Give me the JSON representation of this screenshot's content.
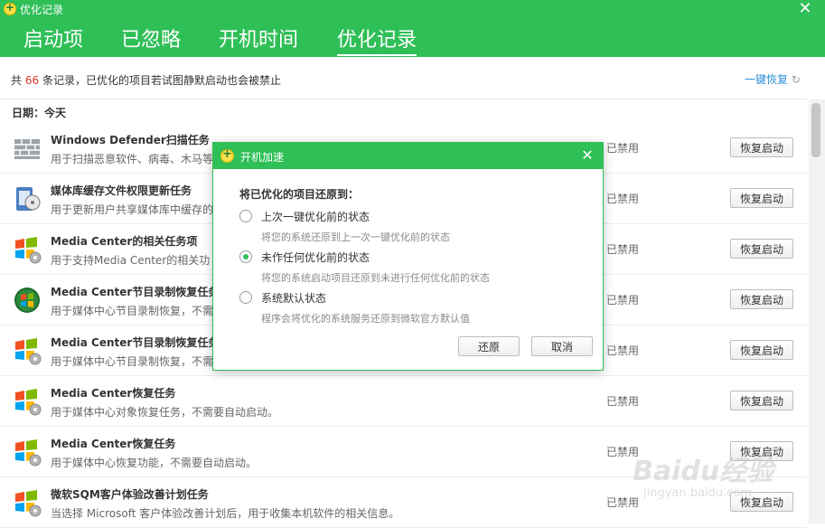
{
  "window": {
    "title": "优化记录",
    "close_glyph": "✕"
  },
  "tabs": [
    {
      "label": "启动项",
      "active": false
    },
    {
      "label": "已忽略",
      "active": false
    },
    {
      "label": "开机时间",
      "active": false
    },
    {
      "label": "优化记录",
      "active": true
    }
  ],
  "summary": {
    "prefix": "共",
    "count": "66",
    "suffix": "条记录，已优化的项目若试图静默启动也会被禁止"
  },
  "restore_all": {
    "label": "一键恢复",
    "icon": "refresh-icon"
  },
  "date_label": "日期：今天",
  "records": [
    {
      "icon": "wall-icon",
      "name": "Windows Defender扫描任务",
      "desc": "用于扫描恶意软件、病毒、木马等",
      "status": "已禁用",
      "button": "恢复启动"
    },
    {
      "icon": "media-library-icon",
      "name": "媒体库缓存文件权限更新任务",
      "desc": "用于更新用户共享媒体库中缓存的",
      "status": "已禁用",
      "button": "恢复启动"
    },
    {
      "icon": "windows-gear-icon",
      "name": "Media Center的相关任务项",
      "desc": "用于支持Media Center的相关功",
      "status": "已禁用",
      "button": "恢复启动"
    },
    {
      "icon": "windows-orb-icon",
      "name": "Media Center节目录制恢复任务",
      "desc": "用于媒体中心节目录制恢复，不需",
      "status": "已禁用",
      "button": "恢复启动"
    },
    {
      "icon": "windows-gear-icon",
      "name": "Media Center节目录制恢复任务",
      "desc": "用于媒体中心节目录制恢复，不需",
      "status": "已禁用",
      "button": "恢复启动"
    },
    {
      "icon": "windows-gear-icon",
      "name": "Media Center恢复任务",
      "desc": "用于媒体中心对象恢复任务，不需要自动启动。",
      "status": "已禁用",
      "button": "恢复启动"
    },
    {
      "icon": "windows-gear-icon",
      "name": "Media Center恢复任务",
      "desc": "用于媒体中心恢复功能，不需要自动启动。",
      "status": "已禁用",
      "button": "恢复启动"
    },
    {
      "icon": "windows-gear-icon",
      "name": "微软SQM客户体验改善计划任务",
      "desc": "当选择 Microsoft 客户体验改善计划后，用于收集本机软件的相关信息。",
      "status": "已禁用",
      "button": "恢复启动"
    }
  ],
  "dialog": {
    "title": "开机加速",
    "prompt": "将已优化的项目还原到：",
    "options": [
      {
        "label": "上次一键优化前的状态",
        "desc": "将您的系统还原到上一次一键优化前的状态",
        "checked": false
      },
      {
        "label": "未作任何优化前的状态",
        "desc": "将您的系统启动项目还原到未进行任何优化前的状态",
        "checked": true
      },
      {
        "label": "系统默认状态",
        "desc": "程序会将优化的系统服务还原到微软官方默认值",
        "checked": false
      }
    ],
    "restore_button": "还原",
    "cancel_button": "取消",
    "close_glyph": "✕"
  },
  "watermark": {
    "text": "Baidu经验",
    "sub": "jingyan.baidu.com"
  },
  "colors": {
    "brand_green": "#2fbf57",
    "count_red": "#e0342f",
    "link_blue": "#2b8fd8"
  }
}
